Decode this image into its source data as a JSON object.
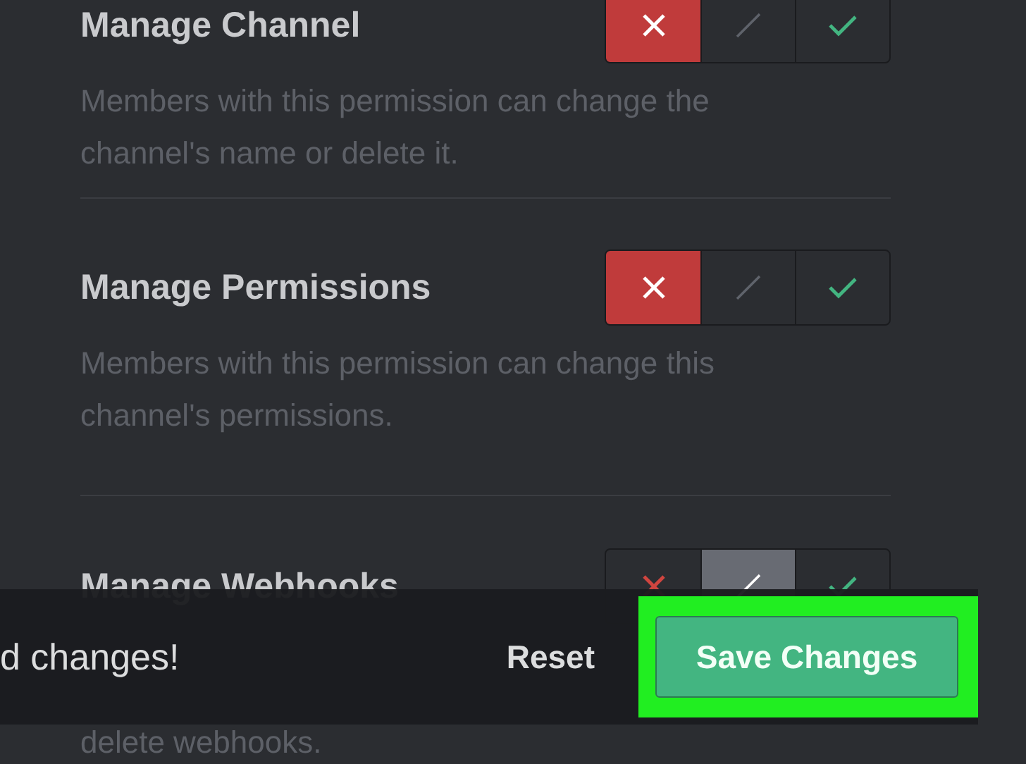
{
  "permissions": [
    {
      "title": "Manage Channel",
      "description": "Members with this permission can change the channel's name or delete it.",
      "options": [
        {
          "kind": "deny",
          "selected": true
        },
        {
          "kind": "neutral",
          "selected": false
        },
        {
          "kind": "allow",
          "selected": false
        }
      ]
    },
    {
      "title": "Manage Permissions",
      "description": "Members with this permission can change this channel's permissions.",
      "options": [
        {
          "kind": "deny",
          "selected": true
        },
        {
          "kind": "neutral",
          "selected": false
        },
        {
          "kind": "allow",
          "selected": false
        }
      ]
    },
    {
      "title": "Manage Webhooks",
      "description": "delete webhooks.",
      "options": [
        {
          "kind": "deny",
          "selected": false
        },
        {
          "kind": "neutral",
          "selected": true
        },
        {
          "kind": "allow",
          "selected": false
        }
      ]
    }
  ],
  "notice_bar": {
    "message": "d changes!",
    "reset_label": "Reset",
    "save_label": "Save Changes",
    "save_highlighted": true
  }
}
